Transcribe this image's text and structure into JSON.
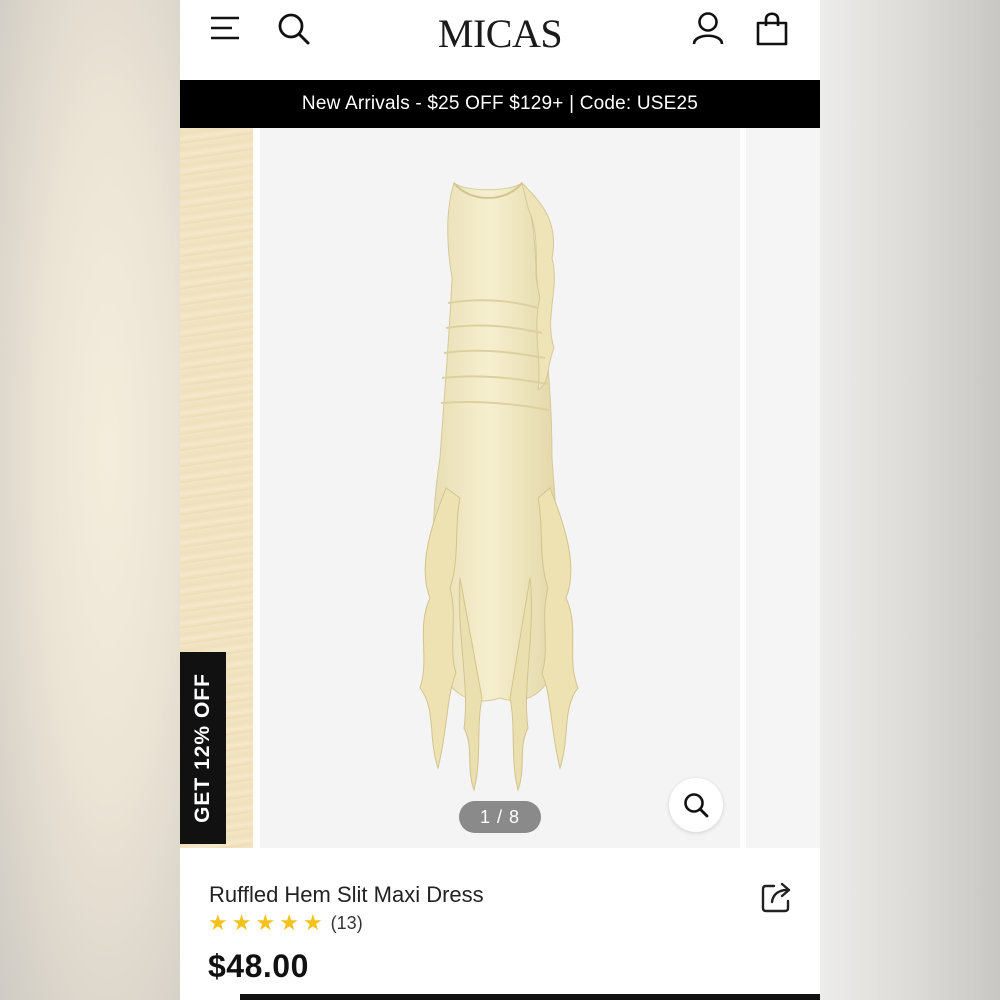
{
  "header": {
    "logo": "MICAS",
    "icons": [
      "menu-icon",
      "search-icon",
      "account-icon",
      "cart-icon"
    ]
  },
  "promo": {
    "text": "New Arrivals - $25 OFF $129+ | Code: USE25"
  },
  "gallery": {
    "counter": "1 / 8",
    "badge": "GET 12% OFF",
    "zoom_icon": "zoom-icon"
  },
  "product": {
    "title": "Ruffled Hem Slit Maxi Dress",
    "rating": 5,
    "rating_max": 5,
    "review_count": "(13)",
    "price": "$48.00"
  },
  "colors": {
    "promo_bg": "#000000",
    "star": "#f4c21b",
    "dress": "#f3ecc6"
  }
}
